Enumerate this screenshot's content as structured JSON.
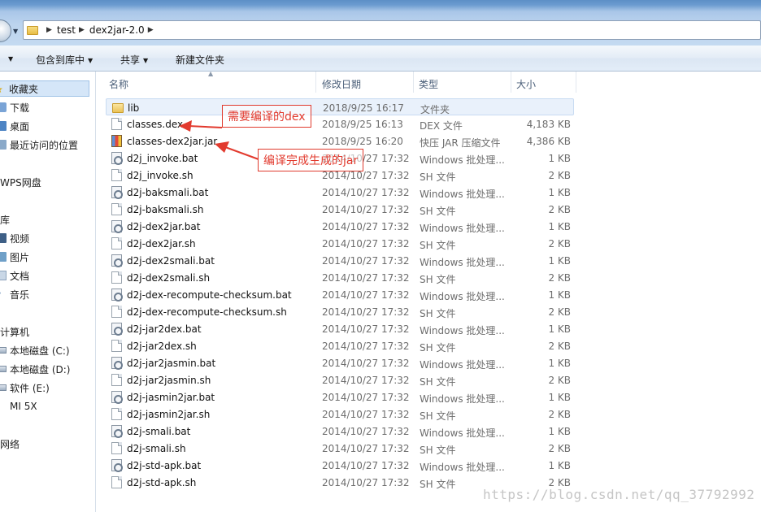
{
  "address": {
    "crumbs": [
      "test",
      "dex2jar-2.0"
    ]
  },
  "toolbar": {
    "include_in_library": "包含到库中",
    "share": "共享",
    "new_folder": "新建文件夹"
  },
  "sidebar": {
    "items": [
      {
        "label": "收藏夹",
        "icon": "star-icon"
      },
      {
        "label": "下载",
        "icon": "download-folder-icon"
      },
      {
        "label": "桌面",
        "icon": "desktop-icon"
      },
      {
        "label": "最近访问的位置",
        "icon": "recent-places-icon"
      },
      {
        "label": "WPS网盘",
        "icon": "cloud-drive-icon"
      },
      {
        "label": "库",
        "icon": "library-icon"
      },
      {
        "label": "视频",
        "icon": "video-icon"
      },
      {
        "label": "图片",
        "icon": "pictures-icon"
      },
      {
        "label": "文档",
        "icon": "documents-icon"
      },
      {
        "label": "音乐",
        "icon": "music-icon"
      },
      {
        "label": "计算机",
        "icon": "computer-icon"
      },
      {
        "label": "本地磁盘 (C:)",
        "icon": "drive-icon"
      },
      {
        "label": "本地磁盘 (D:)",
        "icon": "drive-icon"
      },
      {
        "label": "软件 (E:)",
        "icon": "drive-icon"
      },
      {
        "label": "MI 5X",
        "icon": "phone-icon"
      },
      {
        "label": "网络",
        "icon": "network-icon"
      }
    ]
  },
  "columns": {
    "name": "名称",
    "modified": "修改日期",
    "type": "类型",
    "size": "大小"
  },
  "files": [
    {
      "name": "lib",
      "date": "2018/9/25 16:17",
      "type": "文件夹",
      "size": "",
      "icon": "folder"
    },
    {
      "name": "classes.dex",
      "date": "2018/9/25 16:13",
      "type": "DEX 文件",
      "size": "4,183 KB",
      "icon": "file"
    },
    {
      "name": "classes-dex2jar.jar",
      "date": "2018/9/25 16:20",
      "type": "快压 JAR 压缩文件",
      "size": "4,386 KB",
      "icon": "jar"
    },
    {
      "name": "d2j_invoke.bat",
      "date": "2014/10/27 17:32",
      "type": "Windows 批处理...",
      "size": "1 KB",
      "icon": "bat"
    },
    {
      "name": "d2j_invoke.sh",
      "date": "2014/10/27 17:32",
      "type": "SH 文件",
      "size": "2 KB",
      "icon": "file"
    },
    {
      "name": "d2j-baksmali.bat",
      "date": "2014/10/27 17:32",
      "type": "Windows 批处理...",
      "size": "1 KB",
      "icon": "bat"
    },
    {
      "name": "d2j-baksmali.sh",
      "date": "2014/10/27 17:32",
      "type": "SH 文件",
      "size": "2 KB",
      "icon": "file"
    },
    {
      "name": "d2j-dex2jar.bat",
      "date": "2014/10/27 17:32",
      "type": "Windows 批处理...",
      "size": "1 KB",
      "icon": "bat"
    },
    {
      "name": "d2j-dex2jar.sh",
      "date": "2014/10/27 17:32",
      "type": "SH 文件",
      "size": "2 KB",
      "icon": "file"
    },
    {
      "name": "d2j-dex2smali.bat",
      "date": "2014/10/27 17:32",
      "type": "Windows 批处理...",
      "size": "1 KB",
      "icon": "bat"
    },
    {
      "name": "d2j-dex2smali.sh",
      "date": "2014/10/27 17:32",
      "type": "SH 文件",
      "size": "2 KB",
      "icon": "file"
    },
    {
      "name": "d2j-dex-recompute-checksum.bat",
      "date": "2014/10/27 17:32",
      "type": "Windows 批处理...",
      "size": "1 KB",
      "icon": "bat"
    },
    {
      "name": "d2j-dex-recompute-checksum.sh",
      "date": "2014/10/27 17:32",
      "type": "SH 文件",
      "size": "2 KB",
      "icon": "file"
    },
    {
      "name": "d2j-jar2dex.bat",
      "date": "2014/10/27 17:32",
      "type": "Windows 批处理...",
      "size": "1 KB",
      "icon": "bat"
    },
    {
      "name": "d2j-jar2dex.sh",
      "date": "2014/10/27 17:32",
      "type": "SH 文件",
      "size": "2 KB",
      "icon": "file"
    },
    {
      "name": "d2j-jar2jasmin.bat",
      "date": "2014/10/27 17:32",
      "type": "Windows 批处理...",
      "size": "1 KB",
      "icon": "bat"
    },
    {
      "name": "d2j-jar2jasmin.sh",
      "date": "2014/10/27 17:32",
      "type": "SH 文件",
      "size": "2 KB",
      "icon": "file"
    },
    {
      "name": "d2j-jasmin2jar.bat",
      "date": "2014/10/27 17:32",
      "type": "Windows 批处理...",
      "size": "1 KB",
      "icon": "bat"
    },
    {
      "name": "d2j-jasmin2jar.sh",
      "date": "2014/10/27 17:32",
      "type": "SH 文件",
      "size": "2 KB",
      "icon": "file"
    },
    {
      "name": "d2j-smali.bat",
      "date": "2014/10/27 17:32",
      "type": "Windows 批处理...",
      "size": "1 KB",
      "icon": "bat"
    },
    {
      "name": "d2j-smali.sh",
      "date": "2014/10/27 17:32",
      "type": "SH 文件",
      "size": "2 KB",
      "icon": "file"
    },
    {
      "name": "d2j-std-apk.bat",
      "date": "2014/10/27 17:32",
      "type": "Windows 批处理...",
      "size": "1 KB",
      "icon": "bat"
    },
    {
      "name": "d2j-std-apk.sh",
      "date": "2014/10/27 17:32",
      "type": "SH 文件",
      "size": "2 KB",
      "icon": "file"
    }
  ],
  "annotations": {
    "dex_note": "需要编译的dex",
    "jar_note": "编译完成生成的jar",
    "color": "#e23a2e"
  },
  "watermark": "https://blog.csdn.net/qq_37792992"
}
